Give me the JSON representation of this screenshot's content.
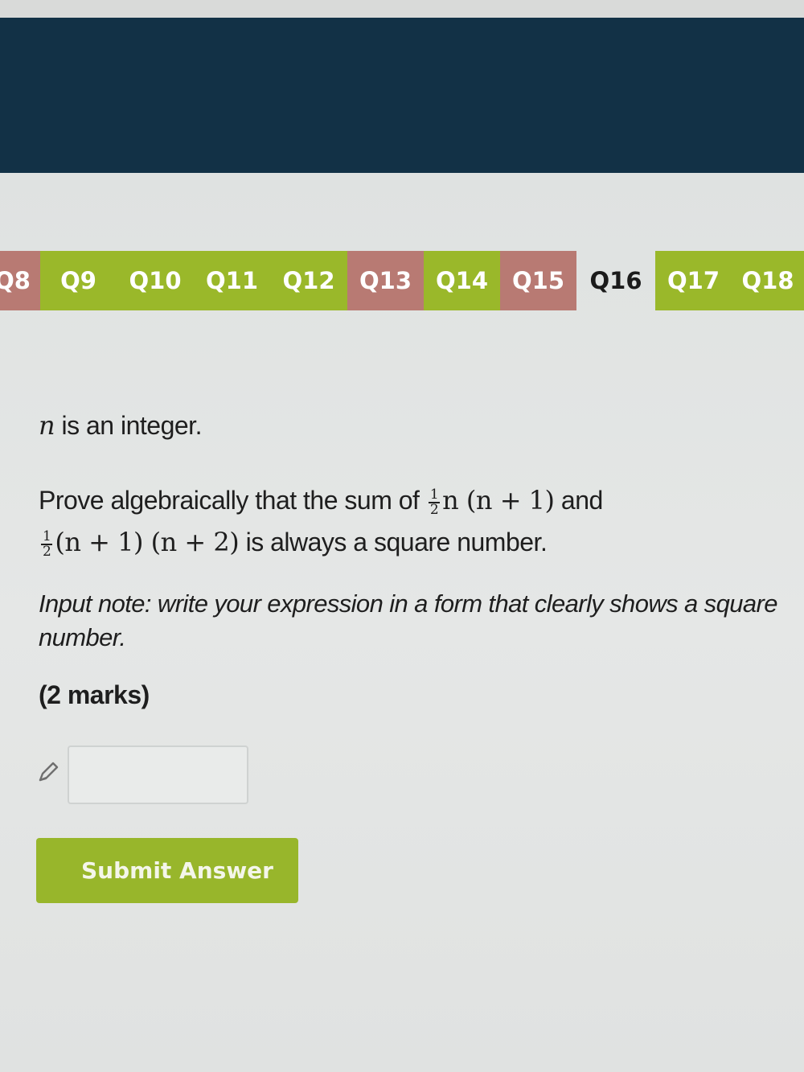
{
  "nav": {
    "tabs": [
      {
        "label": "Q8",
        "status": "red"
      },
      {
        "label": "Q9",
        "status": "green"
      },
      {
        "label": "Q10",
        "status": "green"
      },
      {
        "label": "Q11",
        "status": "green"
      },
      {
        "label": "Q12",
        "status": "green"
      },
      {
        "label": "Q13",
        "status": "red"
      },
      {
        "label": "Q14",
        "status": "green"
      },
      {
        "label": "Q15",
        "status": "red"
      },
      {
        "label": "Q16",
        "status": "current"
      },
      {
        "label": "Q17",
        "status": "green"
      },
      {
        "label": "Q18",
        "status": "green"
      }
    ]
  },
  "question": {
    "line1_var": "n",
    "line1_text": " is an integer.",
    "line2_prefix": "Prove algebraically that the sum of ",
    "frac_num": "1",
    "frac_den": "2",
    "expr_a": "n (n + 1)",
    "and_text": " and",
    "expr_b": "(n + 1) (n + 2)",
    "line2_suffix": " is always a square number.",
    "input_note": "Input note: write your expression in a form that clearly shows a square number.",
    "marks": "(2 marks)"
  },
  "answer": {
    "value": ""
  },
  "submit_label": "Submit Answer",
  "colors": {
    "header": "#123146",
    "tab_green": "#9ab82a",
    "tab_red": "#b87a73",
    "submit": "#98b62b"
  },
  "icons": {
    "answer": "pencil-icon"
  }
}
